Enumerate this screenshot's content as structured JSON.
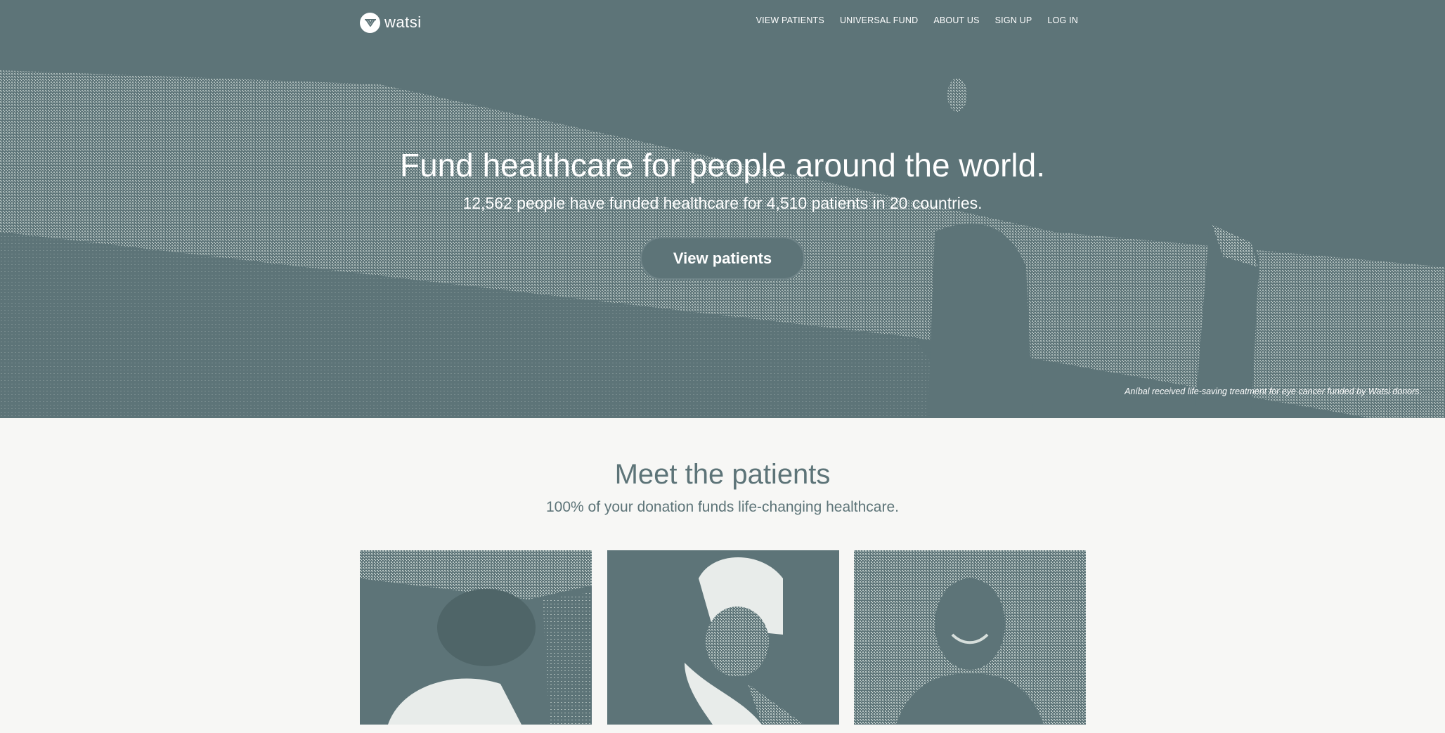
{
  "brand": {
    "name": "watsi",
    "logo_icon": "watsi-logo-icon"
  },
  "nav": {
    "items": [
      {
        "label": "VIEW PATIENTS"
      },
      {
        "label": "UNIVERSAL FUND"
      },
      {
        "label": "ABOUT US"
      },
      {
        "label": "SIGN UP"
      },
      {
        "label": "LOG IN"
      }
    ]
  },
  "hero": {
    "title": "Fund healthcare for people around the world.",
    "subtitle": "12,562 people have funded healthcare for 4,510 patients in 20 countries.",
    "button_label": "View patients",
    "caption": "Aníbal received life-saving treatment for eye cancer funded by Watsi donors."
  },
  "patients_section": {
    "title": "Meet the patients",
    "subtitle": "100% of your donation funds life-changing healthcare."
  },
  "colors": {
    "accent": "#5d7478",
    "background": "#f7f7f5",
    "text_light": "#ffffff"
  }
}
